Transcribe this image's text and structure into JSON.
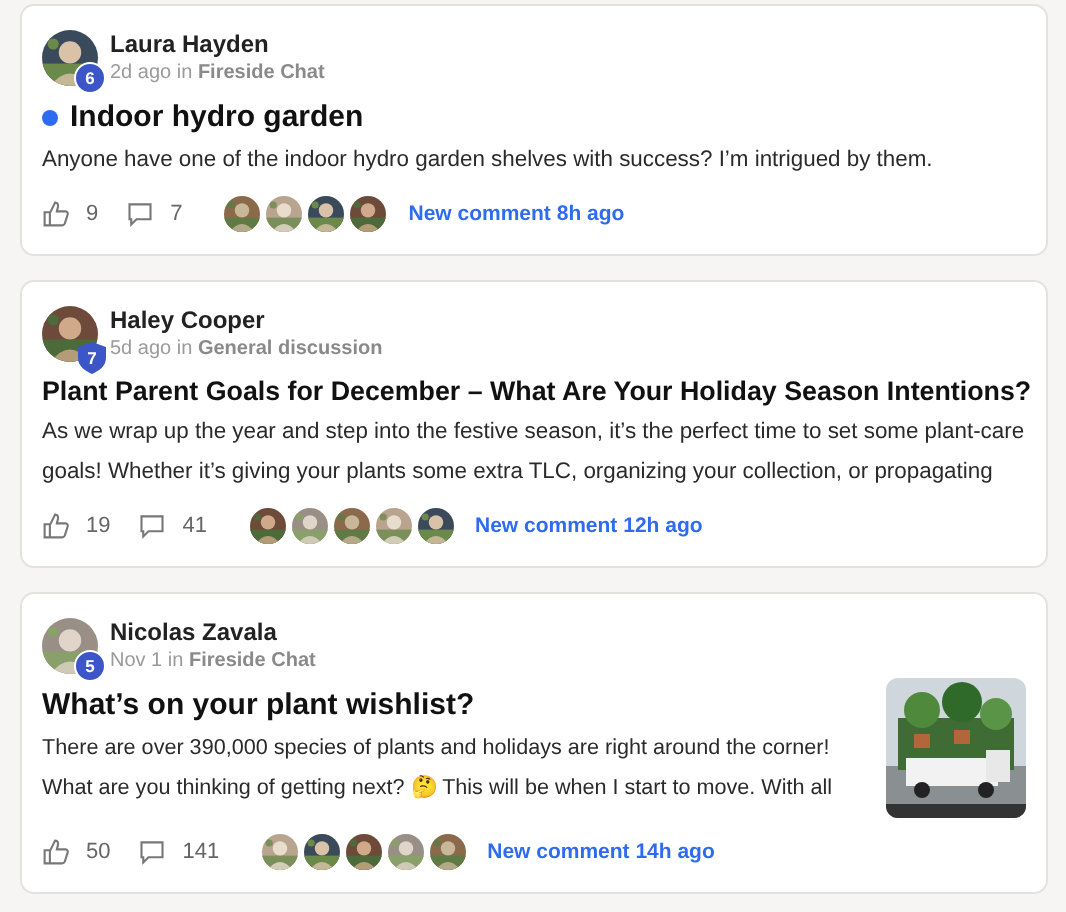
{
  "posts": [
    {
      "author": "Laura Hayden",
      "badge": {
        "kind": "circle",
        "text": "6"
      },
      "time": "2d ago",
      "in": "in",
      "group": "Fireside Chat",
      "unread": true,
      "title": "Indoor hydro garden",
      "body": "Anyone have one of the indoor hydro garden shelves with success? I’m intrigued by them.",
      "likes": "9",
      "comments": "7",
      "new_comment": "New comment 8h ago",
      "has_image": false
    },
    {
      "author": "Haley Cooper",
      "badge": {
        "kind": "shield",
        "text": "7"
      },
      "time": "5d ago",
      "in": "in",
      "group": "General discussion",
      "unread": false,
      "title": "Plant Parent Goals for December – What Are Your Holiday Season Intentions?",
      "body": "As we wrap up the year and step into the festive season, it’s the perfect time to set some plant-care goals! Whether it’s giving your plants some extra TLC, organizing your collection, or propagating",
      "likes": "19",
      "comments": "41",
      "new_comment": "New comment 12h ago",
      "has_image": false
    },
    {
      "author": "Nicolas Zavala",
      "badge": {
        "kind": "circle",
        "text": "5"
      },
      "time": "Nov 1",
      "in": "in",
      "group": "Fireside Chat",
      "unread": false,
      "title": "What’s on your plant wishlist?",
      "body": "There are over 390,000 species of plants and holidays are right around the corner! What are you thinking of getting next? 🤔  This will be when I start to move. With all",
      "likes": "50",
      "comments": "141",
      "new_comment": "New comment 14h ago",
      "has_image": true
    }
  ]
}
